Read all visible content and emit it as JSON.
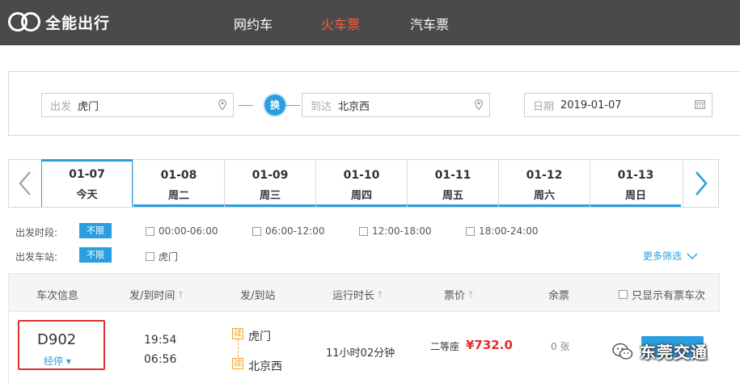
{
  "header": {
    "brand": "全能出行",
    "nav": [
      {
        "label": "网约车",
        "active": false
      },
      {
        "label": "火车票",
        "active": true
      },
      {
        "label": "汽车票",
        "active": false
      }
    ]
  },
  "search": {
    "from_label": "出发",
    "from_value": "虎门",
    "swap_label": "换",
    "to_label": "到达",
    "to_value": "北京西",
    "date_label": "日期",
    "date_value": "2019-01-07"
  },
  "dates": [
    {
      "date": "01-07",
      "weekday": "今天",
      "active": true
    },
    {
      "date": "01-08",
      "weekday": "周二",
      "active": false
    },
    {
      "date": "01-09",
      "weekday": "周三",
      "active": false
    },
    {
      "date": "01-10",
      "weekday": "周四",
      "active": false
    },
    {
      "date": "01-11",
      "weekday": "周五",
      "active": false
    },
    {
      "date": "01-12",
      "weekday": "周六",
      "active": false
    },
    {
      "date": "01-13",
      "weekday": "周日",
      "active": false
    }
  ],
  "filters": {
    "time_label": "出发时段:",
    "station_label": "出发车站:",
    "unlimited": "不限",
    "time_options": [
      "00:00-06:00",
      "06:00-12:00",
      "12:00-18:00",
      "18:00-24:00"
    ],
    "station_options": [
      "虎门"
    ],
    "more": "更多筛选"
  },
  "table": {
    "headers": {
      "train": "车次信息",
      "time": "发/到时间",
      "station": "发/到站",
      "duration": "运行时长",
      "price": "票价",
      "remain": "余票",
      "only_available": "只显示有票车次"
    },
    "rows": [
      {
        "train_no": "D902",
        "stops": "经停",
        "depart_time": "19:54",
        "arrive_time": "06:56",
        "depart_badge": "过",
        "arrive_badge": "过",
        "depart_station": "虎门",
        "arrive_station": "北京西",
        "duration": "11小时02分钟",
        "seat": "二等座",
        "price": "¥732.0",
        "remain": "0 张"
      }
    ]
  },
  "watermark": "东莞交通",
  "colors": {
    "accent": "#2a9fe0",
    "active_nav": "#ff5c3a",
    "price": "#e0302a",
    "header_bg": "#4a4a4a"
  }
}
